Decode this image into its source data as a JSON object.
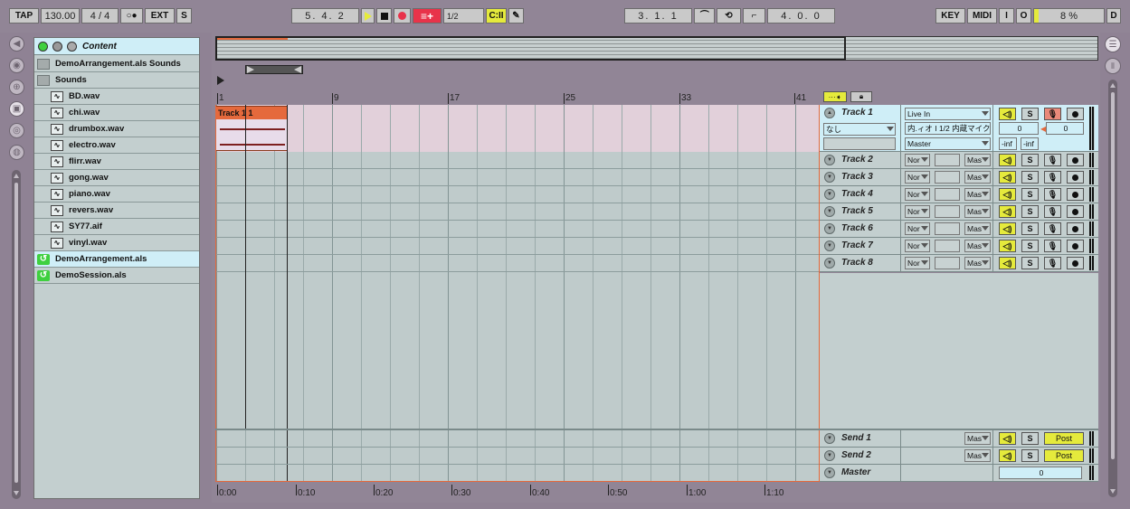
{
  "transport": {
    "tap": "TAP",
    "tempo": "130.00",
    "signature": "4 / 4",
    "metronome": "○●",
    "ext": "EXT",
    "s": "S",
    "position": "5.  4.  2",
    "quantize": "1/2",
    "loop_start": "3.  1.  1",
    "loop_length": "4.  0.  0",
    "key": "KEY",
    "midi": "MIDI",
    "i": "I",
    "o": "O",
    "cpu": "8 %",
    "d": "D"
  },
  "browser": {
    "title": "Content",
    "items": [
      {
        "label": "DemoArrangement.als Sounds",
        "type": "folder",
        "indent": 0
      },
      {
        "label": "Sounds",
        "type": "folder",
        "indent": 0
      },
      {
        "label": "BD.wav",
        "type": "wav",
        "indent": 1
      },
      {
        "label": "chi.wav",
        "type": "wav",
        "indent": 1
      },
      {
        "label": "drumbox.wav",
        "type": "wav",
        "indent": 1
      },
      {
        "label": "electro.wav",
        "type": "wav",
        "indent": 1
      },
      {
        "label": "flirr.wav",
        "type": "wav",
        "indent": 1
      },
      {
        "label": "gong.wav",
        "type": "wav",
        "indent": 1
      },
      {
        "label": "piano.wav",
        "type": "wav",
        "indent": 1
      },
      {
        "label": "revers.wav",
        "type": "wav",
        "indent": 1
      },
      {
        "label": "SY77.aif",
        "type": "wav",
        "indent": 1
      },
      {
        "label": "vinyl.wav",
        "type": "wav",
        "indent": 1
      },
      {
        "label": "DemoArrangement.als",
        "type": "als",
        "indent": 0,
        "selected": true
      },
      {
        "label": "DemoSession.als",
        "type": "als",
        "indent": 0
      }
    ]
  },
  "ruler": {
    "bars": [
      "1",
      "9",
      "17",
      "25",
      "33",
      "41"
    ],
    "times": [
      "0:00",
      "0:10",
      "0:20",
      "0:30",
      "0:40",
      "0:50",
      "1:00",
      "1:10"
    ]
  },
  "clip": {
    "label": "Track 1  1"
  },
  "track1": {
    "name": "Track 1",
    "input_type": "なし",
    "input_channel": "",
    "monitor": "Live In",
    "monitor_sub": "内.ィオ I 1/2   内蔵マイク",
    "output": "Master",
    "volume": "0",
    "pan": "0",
    "peak_l": "-inf",
    "peak_r": "-inf",
    "solo": "S"
  },
  "tracks": [
    {
      "name": "Track 2",
      "in": "Nor",
      "out": "Mas",
      "solo": "S"
    },
    {
      "name": "Track 3",
      "in": "Nor",
      "out": "Mas",
      "solo": "S"
    },
    {
      "name": "Track 4",
      "in": "Nor",
      "out": "Mas",
      "solo": "S"
    },
    {
      "name": "Track 5",
      "in": "Nor",
      "out": "Mas",
      "solo": "S"
    },
    {
      "name": "Track 6",
      "in": "Nor",
      "out": "Mas",
      "solo": "S"
    },
    {
      "name": "Track 7",
      "in": "Nor",
      "out": "Mas",
      "solo": "S"
    },
    {
      "name": "Track 8",
      "in": "Nor",
      "out": "Mas",
      "solo": "S"
    }
  ],
  "sends": [
    {
      "name": "Send 1",
      "out": "Mas",
      "solo": "S",
      "post": "Post"
    },
    {
      "name": "Send 2",
      "out": "Mas",
      "solo": "S",
      "post": "Post"
    }
  ],
  "master": {
    "name": "Master",
    "volume": "0"
  },
  "colors": {
    "accent": "#e5ea3c",
    "clip": "#e5693c",
    "record": "#e8334a",
    "selected_track": "#e2d0da"
  }
}
